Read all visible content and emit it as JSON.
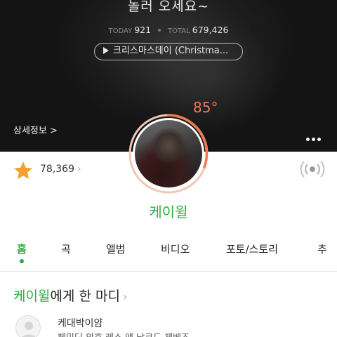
{
  "hero": {
    "headline": "놀러 오세요~",
    "today_label": "TODAY",
    "today_value": "921",
    "total_label": "TOTAL",
    "total_value": "679,426",
    "song": "크리스마스데이 (Christma...",
    "detail_link": "상세정보 >",
    "temperature": "85°"
  },
  "profile": {
    "fan_count": "78,369",
    "artist_name": "케이윌"
  },
  "tabs": [
    "홈",
    "곡",
    "앨범",
    "비디오",
    "포토/스토리",
    "추"
  ],
  "active_tab": 0,
  "comments": {
    "header_artist": "케이윌",
    "header_rest": "에게 한 마디",
    "first_user": "케대박이얌",
    "first_text": "페미딘 외호 레스 앤 낙코드 제베즈"
  },
  "colors": {
    "accent": "#2cae3e",
    "temperature": "#ef7b4f",
    "star": "#f4a030"
  }
}
